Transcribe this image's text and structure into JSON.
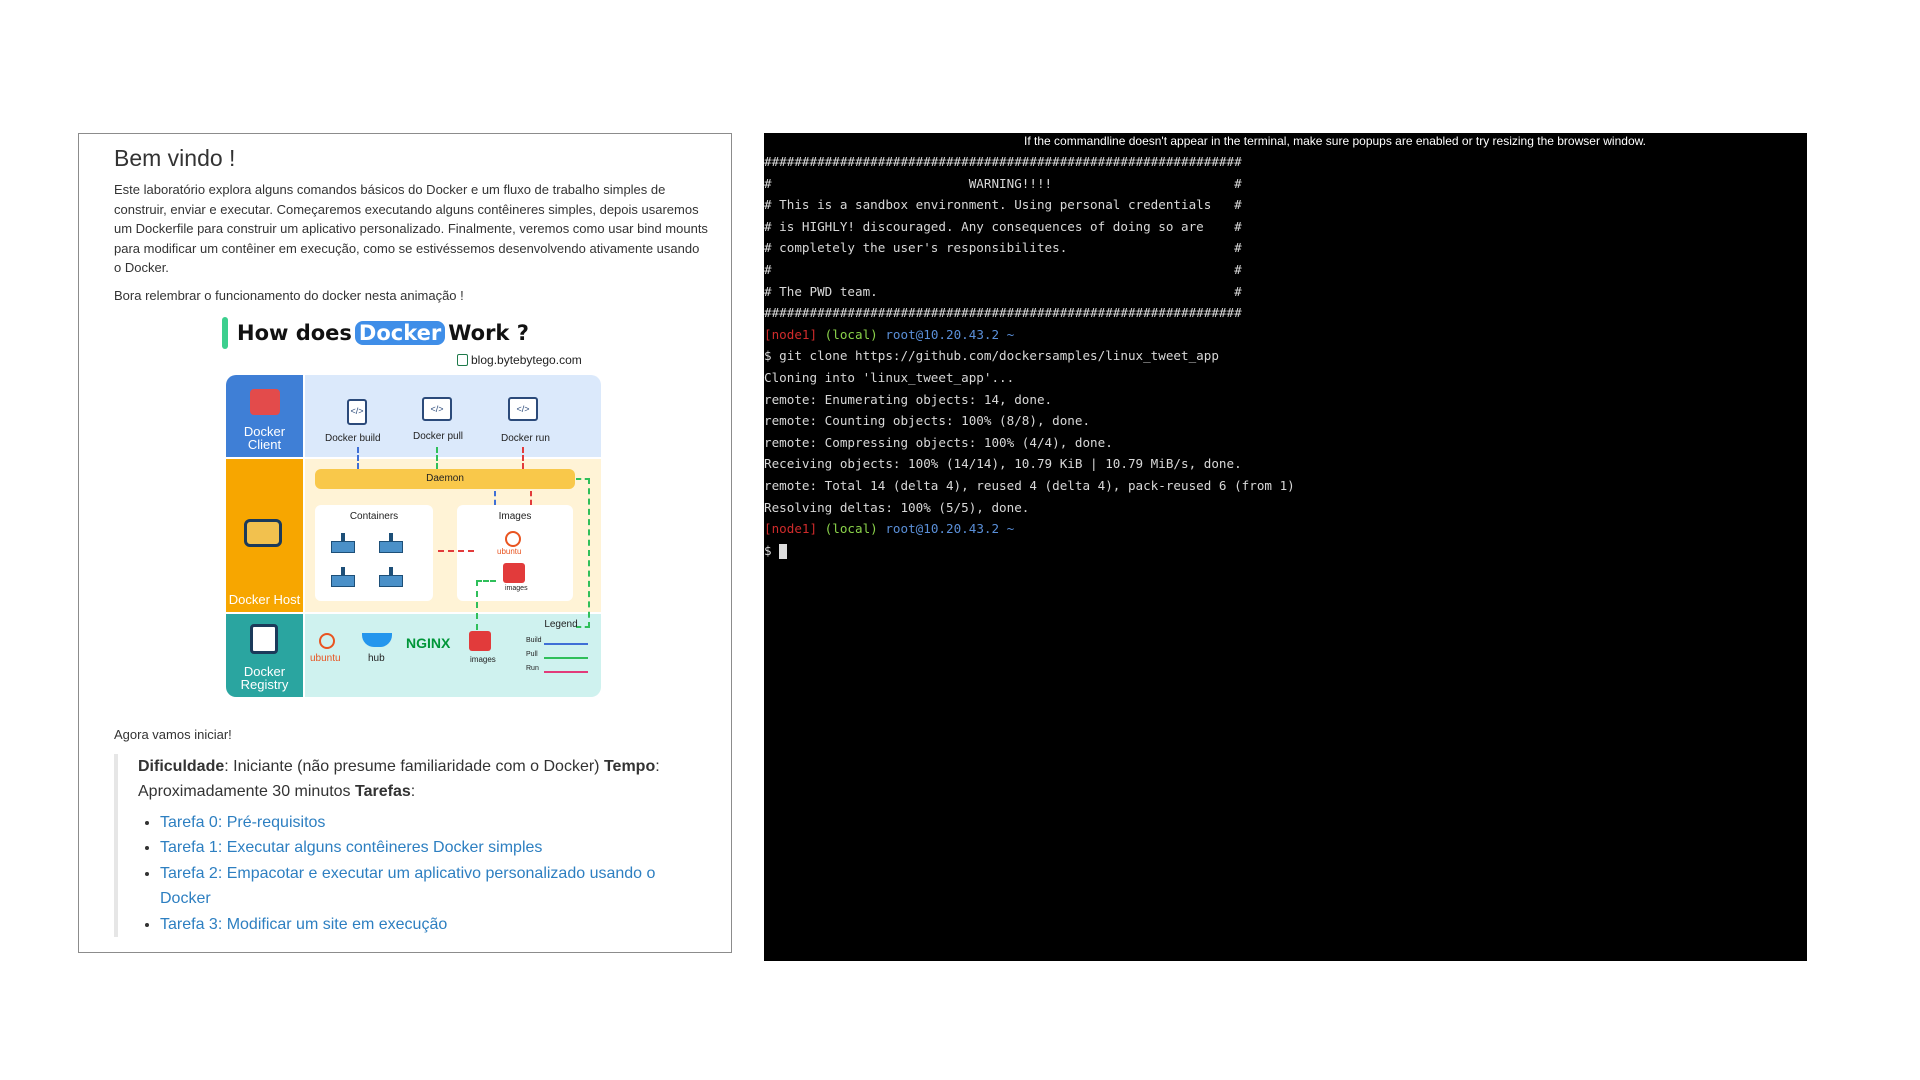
{
  "tutorial": {
    "heading": "Bem vindo !",
    "intro": "Este laboratório explora alguns comandos básicos do Docker e um fluxo de trabalho simples de construir, enviar e executar. Começaremos executando alguns contêineres simples, depois usaremos um Dockerfile para construir um aplicativo personalizado. Finalmente, veremos como usar bind mounts para modificar um contêiner em execução, como se estivéssemos desenvolvendo ativamente usando o Docker.",
    "recall": "Bora relembrar o funcionamento do docker nesta animação !",
    "after_diagram": "Agora vamos iniciar!",
    "difficulty_label": "Dificuldade",
    "difficulty_value": ": Iniciante (não presume familiaridade com o Docker) ",
    "time_label": "Tempo",
    "time_value": ": Aproximadamente 30 minutos ",
    "tasks_label": "Tarefas",
    "tasks_colon": ":",
    "tasks": [
      "Tarefa 0: Pré-requisitos",
      "Tarefa 1: Executar alguns contêineres Docker simples",
      "Tarefa 2: Empacotar e executar um aplicativo personalizado usando o Docker",
      "Tarefa 3: Modificar um site em execução"
    ]
  },
  "diagram": {
    "title_pre": "How does",
    "title_docker": "Docker",
    "title_post": "Work ?",
    "source": "blog.bytebytego.com",
    "row_client": "Docker Client",
    "row_host": "Docker Host",
    "row_registry": "Docker Registry",
    "cmd_build": "Docker build",
    "cmd_pull": "Docker pull",
    "cmd_run": "Docker run",
    "daemon": "Daemon",
    "containers": "Containers",
    "images": "Images",
    "ubuntu_small": "ubuntu",
    "images_small": "images",
    "registry_ubuntu": "ubuntu",
    "registry_hub": "hub",
    "registry_nginx": "NGINX",
    "registry_images": "images",
    "legend": "Legend",
    "legend_build": "Build",
    "legend_pull": "Pull",
    "legend_run": "Run"
  },
  "terminal": {
    "banner": "If the commandline doesn't appear in the terminal, make sure popups are enabled or try resizing the browser window.",
    "hash_line": "###############################################################",
    "warn_lines": [
      "#                          WARNING!!!!                        #",
      "# This is a sandbox environment. Using personal credentials   #",
      "# is HIGHLY! discouraged. Any consequences of doing so are    #",
      "# completely the user's responsibilites.                      #",
      "#                                                             #",
      "# The PWD team.                                               #"
    ],
    "prompt_node": "[node1]",
    "prompt_local": "(local)",
    "prompt_host": "root@10.20.43.2 ~",
    "command": "$ git clone https://github.com/dockersamples/linux_tweet_app",
    "output": [
      "Cloning into 'linux_tweet_app'...",
      "remote: Enumerating objects: 14, done.",
      "remote: Counting objects: 100% (8/8), done.",
      "remote: Compressing objects: 100% (4/4), done.",
      "Receiving objects: 100% (14/14), 10.79 KiB | 10.79 MiB/s, done.",
      "remote: Total 14 (delta 4), reused 4 (delta 4), pack-reused 6 (from 1)",
      "Resolving deltas: 100% (5/5), done."
    ],
    "prompt_node2": "[node1]",
    "prompt_local2": "(local)",
    "prompt_host2": "root@10.20.43.2 ~",
    "prompt_symbol": "$ "
  },
  "colors": {
    "link": "#2d7fc1",
    "terminal_bg": "#000000",
    "prompt_node": "#cf2b2b",
    "prompt_local": "#8ad24a",
    "prompt_host": "#5a8fd8"
  }
}
